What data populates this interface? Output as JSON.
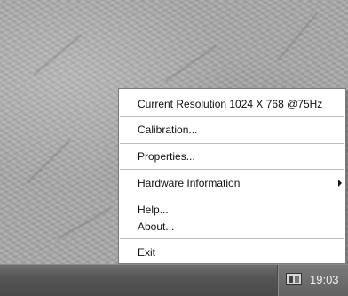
{
  "context_menu": {
    "items": [
      {
        "label": "Current Resolution  1024 X 768 @75Hz"
      },
      {
        "label": "Calibration..."
      },
      {
        "label": "Properties..."
      },
      {
        "label": "Hardware Information",
        "submenu": true
      },
      {
        "label": "Help..."
      },
      {
        "label": "About..."
      },
      {
        "label": "Exit"
      }
    ]
  },
  "taskbar": {
    "tray_icon": "display-settings-icon",
    "clock": "19:03"
  },
  "colors": {
    "menu_background": "#ffffff",
    "menu_border": "#7d7d7d",
    "separator": "#bdbdbd",
    "taskbar": "#555555",
    "clock_text": "#f2f2f2"
  }
}
